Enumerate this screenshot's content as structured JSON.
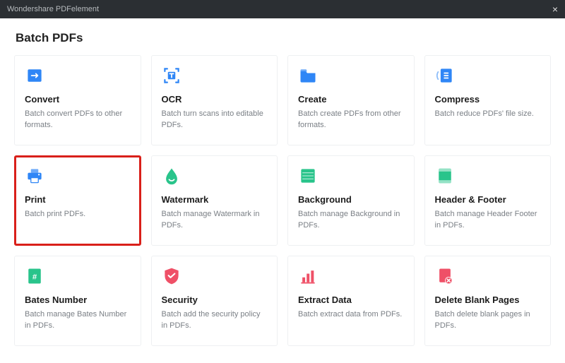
{
  "window": {
    "title": "Wondershare PDFelement",
    "close_label": "×"
  },
  "page": {
    "heading": "Batch PDFs"
  },
  "cards": [
    {
      "id": "convert",
      "title": "Convert",
      "desc": "Batch convert PDFs to other formats.",
      "icon": "convert-icon",
      "color": "#2f86f6",
      "highlight": false
    },
    {
      "id": "ocr",
      "title": "OCR",
      "desc": "Batch turn scans into editable PDFs.",
      "icon": "ocr-icon",
      "color": "#2f86f6",
      "highlight": false
    },
    {
      "id": "create",
      "title": "Create",
      "desc": "Batch create PDFs from other formats.",
      "icon": "folder-icon",
      "color": "#2f86f6",
      "highlight": false
    },
    {
      "id": "compress",
      "title": "Compress",
      "desc": "Batch reduce PDFs' file size.",
      "icon": "compress-icon",
      "color": "#2f86f6",
      "highlight": false
    },
    {
      "id": "print",
      "title": "Print",
      "desc": "Batch print PDFs.",
      "icon": "printer-icon",
      "color": "#2f86f6",
      "highlight": true
    },
    {
      "id": "watermark",
      "title": "Watermark",
      "desc": "Batch manage Watermark in PDFs.",
      "icon": "watermark-icon",
      "color": "#29c48b",
      "highlight": false
    },
    {
      "id": "background",
      "title": "Background",
      "desc": "Batch manage Background in PDFs.",
      "icon": "background-icon",
      "color": "#29c48b",
      "highlight": false
    },
    {
      "id": "headerfooter",
      "title": "Header & Footer",
      "desc": "Batch manage Header Footer in PDFs.",
      "icon": "headerfooter-icon",
      "color": "#29c48b",
      "highlight": false
    },
    {
      "id": "bates",
      "title": "Bates Number",
      "desc": "Batch manage Bates Number in PDFs.",
      "icon": "bates-icon",
      "color": "#29c48b",
      "highlight": false
    },
    {
      "id": "security",
      "title": "Security",
      "desc": "Batch add the security policy in PDFs.",
      "icon": "shield-icon",
      "color": "#ef5067",
      "highlight": false
    },
    {
      "id": "extract",
      "title": "Extract Data",
      "desc": "Batch extract data from PDFs.",
      "icon": "barchart-icon",
      "color": "#ef5067",
      "highlight": false
    },
    {
      "id": "deleteblank",
      "title": "Delete Blank Pages",
      "desc": "Batch delete blank pages in PDFs.",
      "icon": "delete-page-icon",
      "color": "#ef5067",
      "highlight": false
    }
  ]
}
